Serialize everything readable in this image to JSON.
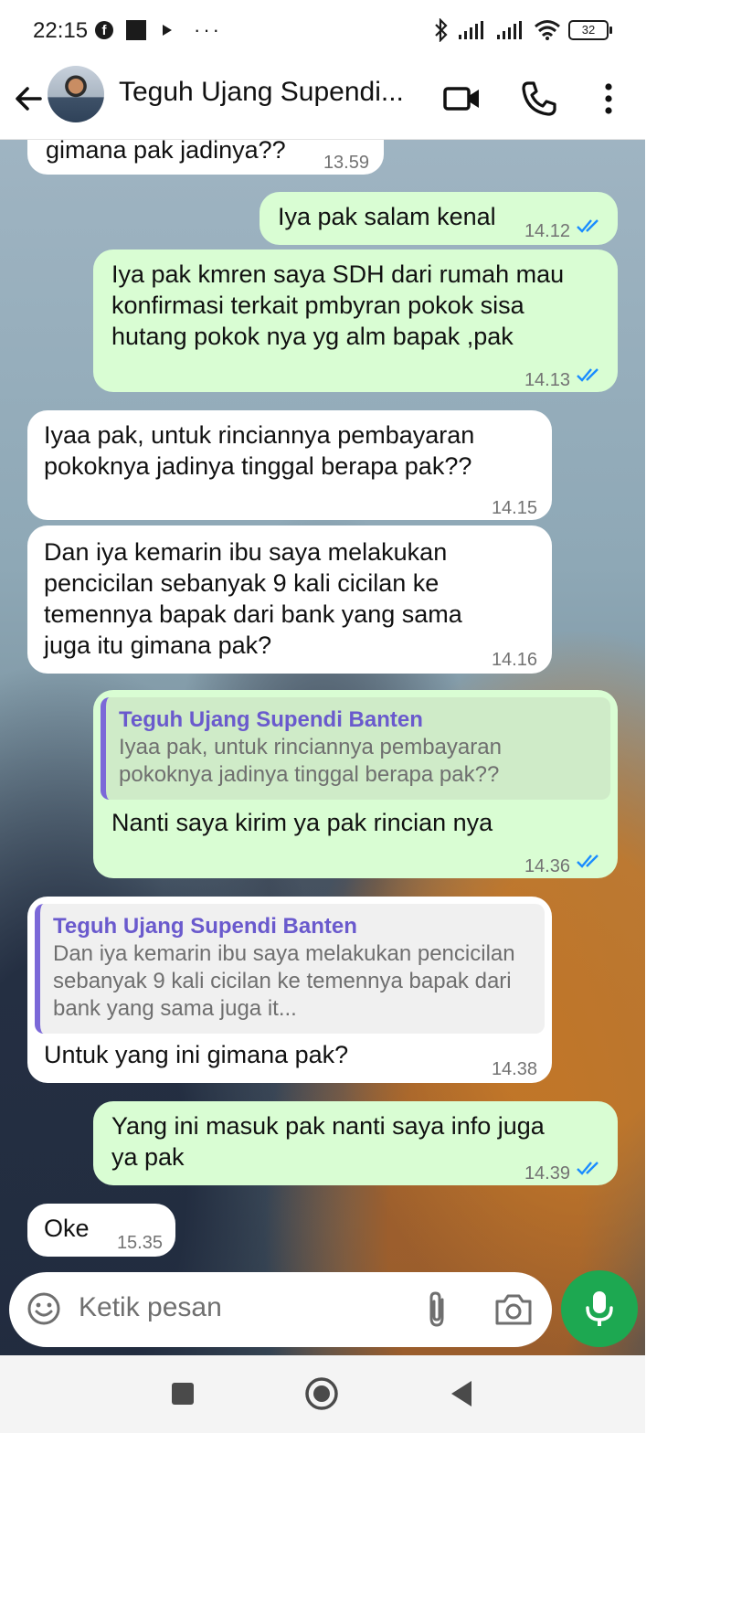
{
  "status_bar": {
    "time": "22:15",
    "battery": "32"
  },
  "header": {
    "contact_name": "Teguh Ujang Supendi..."
  },
  "messages": [
    {
      "text": "gimana pak jadinya??",
      "time": "13.59"
    },
    {
      "text": "Iya pak salam kenal",
      "time": "14.12"
    },
    {
      "text": "Iya pak kmren saya SDH dari rumah mau konfirmasi terkait pmbyran pokok sisa hutang pokok nya yg alm bapak ,pak",
      "time": "14.13"
    },
    {
      "text": "Iyaa pak, untuk rinciannya pembayaran pokoknya jadinya tinggal berapa pak??",
      "time": "14.15"
    },
    {
      "text": "Dan iya kemarin ibu saya melakukan pencicilan sebanyak 9 kali cicilan ke temennya bapak dari bank yang sama juga itu gimana pak?",
      "time": "14.16"
    },
    {
      "quote_name": "Teguh Ujang Supendi Banten",
      "quote_text": "Iyaa pak, untuk rinciannya pembayaran pokoknya jadinya tinggal berapa pak??",
      "text": "Nanti saya kirim ya pak rincian nya",
      "time": "14.36"
    },
    {
      "quote_name": "Teguh Ujang Supendi Banten",
      "quote_text": "Dan iya kemarin ibu saya melakukan pencicilan sebanyak 9 kali cicilan ke temennya bapak dari bank yang sama juga it...",
      "text": "Untuk yang ini gimana pak?",
      "time": "14.38"
    },
    {
      "text": "Yang ini masuk pak nanti saya info juga ya pak",
      "time": "14.39"
    },
    {
      "text": "Oke",
      "time": "15.35"
    }
  ],
  "input": {
    "placeholder": "Ketik pesan"
  },
  "colors": {
    "outgoing_bubble": "#d9fdd3",
    "incoming_bubble": "#ffffff",
    "read_ticks": "#1a8cff",
    "mic_button": "#1da851",
    "quote_name": "#6a5acd"
  },
  "icons": {
    "back": "arrow-left-icon",
    "video": "video-camera-icon",
    "call": "phone-icon",
    "menu": "more-vertical-icon",
    "emoji": "emoji-icon",
    "attach": "paperclip-icon",
    "camera": "camera-icon",
    "mic": "microphone-icon"
  }
}
